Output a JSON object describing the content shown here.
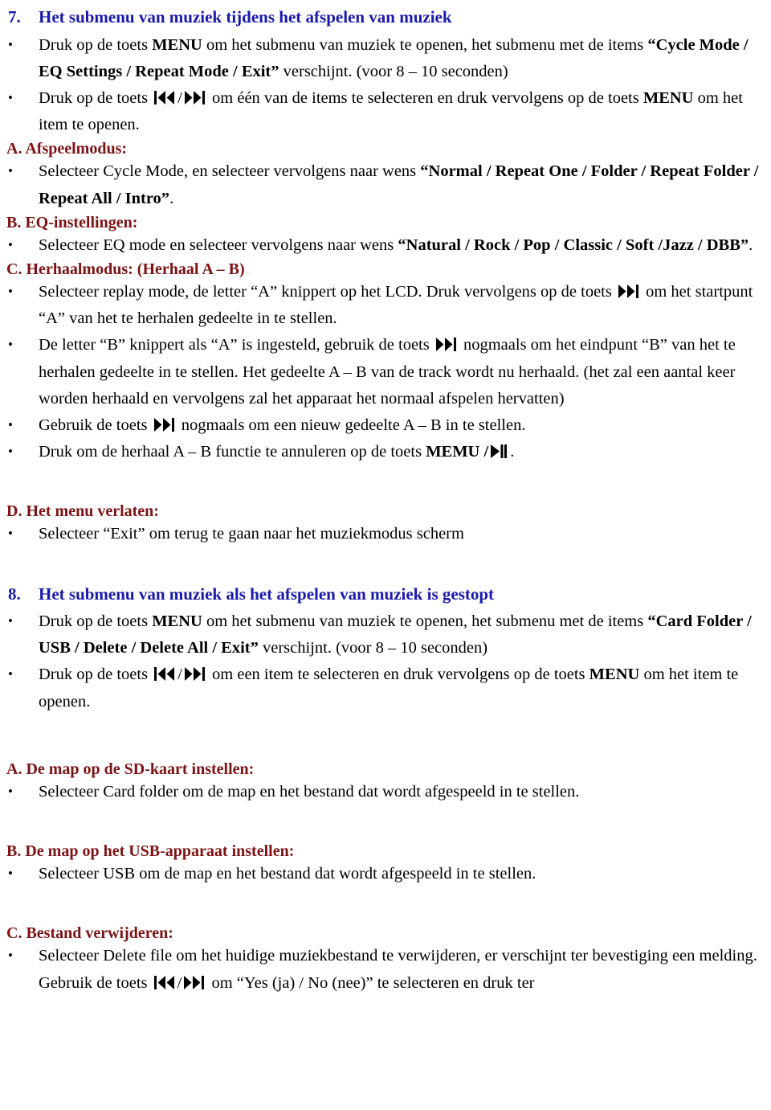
{
  "colors": {
    "heading_blue": "#1a1aaa",
    "subheading_maroon": "#7c1315",
    "body_text": "#000000",
    "page_background": "#ffffff"
  },
  "icons": {
    "prev_track": "prev-track-icon",
    "next_track": "next-track-icon",
    "play_pause": "play-pause-icon"
  },
  "section7": {
    "number": "7.",
    "title": "Het submenu van muziek tijdens het afspelen van muziek",
    "bullet1": {
      "part1": "Druk op de toets ",
      "bold1": "MENU",
      "part2": " om het submenu van muziek te openen, het submenu met de items ",
      "bold2": "“Cycle Mode / EQ Settings / Repeat Mode / Exit”",
      "part3": " verschijnt. (voor 8 – 10 seconden)"
    },
    "bullet2": {
      "part1": "Druk op de toets ",
      "sep": "/",
      "part2": " om één van de items te selecteren en druk vervolgens op de toets ",
      "bold1": "MENU",
      "part3": " om het item te openen."
    },
    "A": {
      "heading": "A. Afspeelmodus:",
      "bullet": {
        "part1": "Selecteer Cycle Mode, en selecteer vervolgens naar wens ",
        "bold1": "“Normal / Repeat One / Folder / Repeat Folder / Repeat All / Intro”",
        "part2": "."
      }
    },
    "B": {
      "heading": "B. EQ-instellingen:",
      "bullet": {
        "part1": "Selecteer EQ mode en selecteer vervolgens naar wens ",
        "bold1": "“Natural / Rock / Pop / Classic / Soft /Jazz / DBB”",
        "part2": "."
      }
    },
    "C": {
      "heading": "C. Herhaalmodus: (Herhaal A – B)",
      "bullet1": {
        "part1": "Selecteer replay mode, de letter “A” knippert op het LCD. Druk vervolgens op de toets ",
        "part2": " om het startpunt “A” van het te herhalen gedeelte in te stellen."
      },
      "bullet2": {
        "part1": "De letter “B” knippert als “A” is ingesteld, gebruik de toets ",
        "part2": " nogmaals om het eindpunt “B” van het te herhalen gedeelte in te stellen. Het gedeelte A – B van de track wordt nu herhaald. (het zal een aantal keer worden herhaald en vervolgens zal het apparaat het normaal afspelen hervatten)"
      },
      "bullet3": {
        "part1": "Gebruik de toets ",
        "part2": " nogmaals om een nieuw gedeelte A – B in te stellen."
      },
      "bullet4": {
        "part1": "Druk om de herhaal A – B functie te annuleren op de toets ",
        "bold1": "MEMU /",
        "part2": "."
      }
    },
    "D": {
      "heading": "D. Het menu verlaten:",
      "bullet": "Selecteer “Exit” om terug te gaan naar het muziekmodus scherm"
    }
  },
  "section8": {
    "number": "8.",
    "title": "Het submenu van muziek als het afspelen van muziek is gestopt",
    "bullet1": {
      "part1": "Druk op de toets ",
      "bold1": "MENU",
      "part2": " om het submenu van muziek te openen, het submenu met de items ",
      "bold2": "“Card Folder / USB / Delete / Delete All / Exit”",
      "part3": " verschijnt. (voor 8 – 10 seconden)"
    },
    "bullet2": {
      "part1": "Druk op de toets ",
      "sep": "/",
      "part2": " om een item te selecteren en druk vervolgens op de toets ",
      "bold1": "MENU",
      "part3": " om het item te openen."
    },
    "A": {
      "heading": "A. De map op de SD-kaart instellen:",
      "bullet": "Selecteer Card folder om de map en het bestand dat wordt afgespeeld in te stellen."
    },
    "B": {
      "heading": "B. De map op het USB-apparaat instellen:",
      "bullet": "Selecteer USB om de map en het bestand dat wordt afgespeeld in te stellen."
    },
    "C": {
      "heading": "C. Bestand verwijderen:",
      "bullet": {
        "part1": "Selecteer Delete file om het huidige muziekbestand te verwijderen, er verschijnt ter bevestiging een melding. Gebruik de toets ",
        "sep": "/",
        "part2": " om “Yes (ja) / No (nee)” te selecteren en druk ter"
      }
    }
  }
}
